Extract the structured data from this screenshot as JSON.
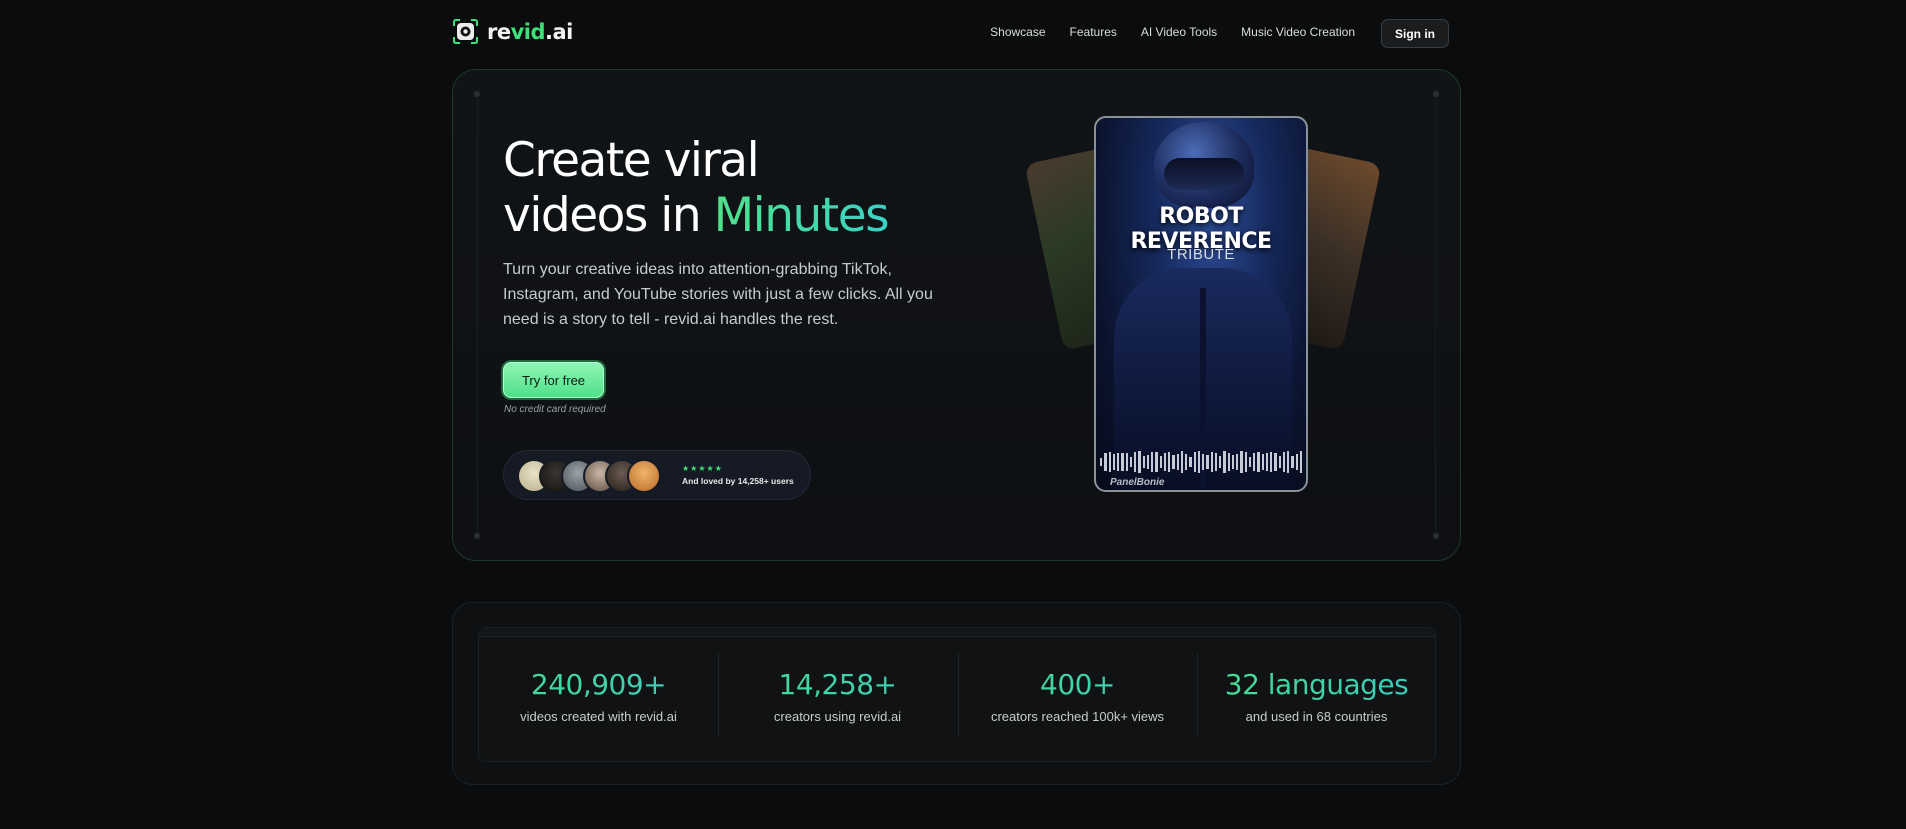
{
  "nav": {
    "logo": {
      "prefix": "re",
      "accent": "vid",
      "suffix": ".ai",
      "icon": "camera-icon"
    },
    "links": [
      "Showcase",
      "Features",
      "AI Video Tools",
      "Music Video Creation"
    ],
    "signin_label": "Sign in"
  },
  "hero": {
    "headline_line1": "Create viral",
    "headline_line2_prefix": "videos in ",
    "headline_highlight": "Minutes",
    "subtitle": "Turn your creative ideas into attention-grabbing TikTok, Instagram, and YouTube stories with just a few clicks. All you need is a story to tell - revid.ai handles the rest.",
    "cta_label": "Try for free",
    "cta_note": "No credit card required",
    "rating_stars": "★★★★★",
    "loved_text": "And loved by 14,258+ users",
    "phone_title": "ROBOT REVERENCE",
    "phone_subtitle": "TRIBUTE",
    "phone_brand": "PanelBonie"
  },
  "stats": [
    {
      "value": "240,909+",
      "label": "videos created with revid.ai"
    },
    {
      "value": "14,258+",
      "label": "creators using revid.ai"
    },
    {
      "value": "400+",
      "label": "creators reached 100k+ views"
    },
    {
      "value": "32 languages",
      "label": "and used in 68 countries"
    }
  ],
  "colors": {
    "background": "#0b0c0d",
    "accent_green": "#3ee07a",
    "accent_teal": "#39c9c0",
    "cta_bg": "#6cee9f"
  }
}
